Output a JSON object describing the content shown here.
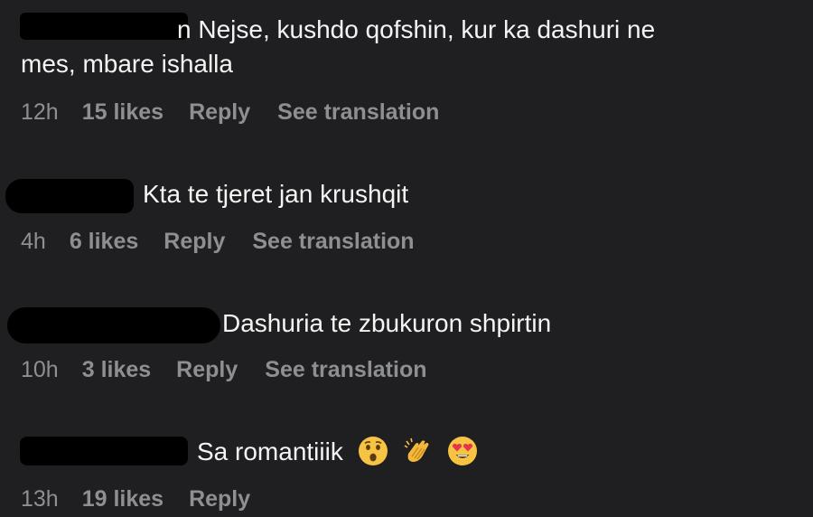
{
  "comments": [
    {
      "text_line1": "n Nejse, kushdo qofshin, kur ka dashuri ne",
      "text_line2": "mes, mbare ishalla",
      "time": "12h",
      "likes": "15 likes",
      "reply": "Reply",
      "translation": "See translation"
    },
    {
      "text": "Kta te tjeret jan krushqit",
      "time": "4h",
      "likes": "6 likes",
      "reply": "Reply",
      "translation": "See translation"
    },
    {
      "text": "Dashuria te zbukuron shpirtin",
      "time": "10h",
      "likes": "3 likes",
      "reply": "Reply",
      "translation": "See translation"
    },
    {
      "text": "Sa romantiiik",
      "emojis": [
        "astonished-face-icon",
        "clapping-hands-icon",
        "heart-eyes-face-icon"
      ],
      "time": "13h",
      "likes": "19 likes",
      "reply": "Reply"
    }
  ],
  "colors": {
    "background": "#1f1f21",
    "text": "#f4f4f4",
    "meta": "#8e8f93",
    "redaction": "#000000"
  }
}
